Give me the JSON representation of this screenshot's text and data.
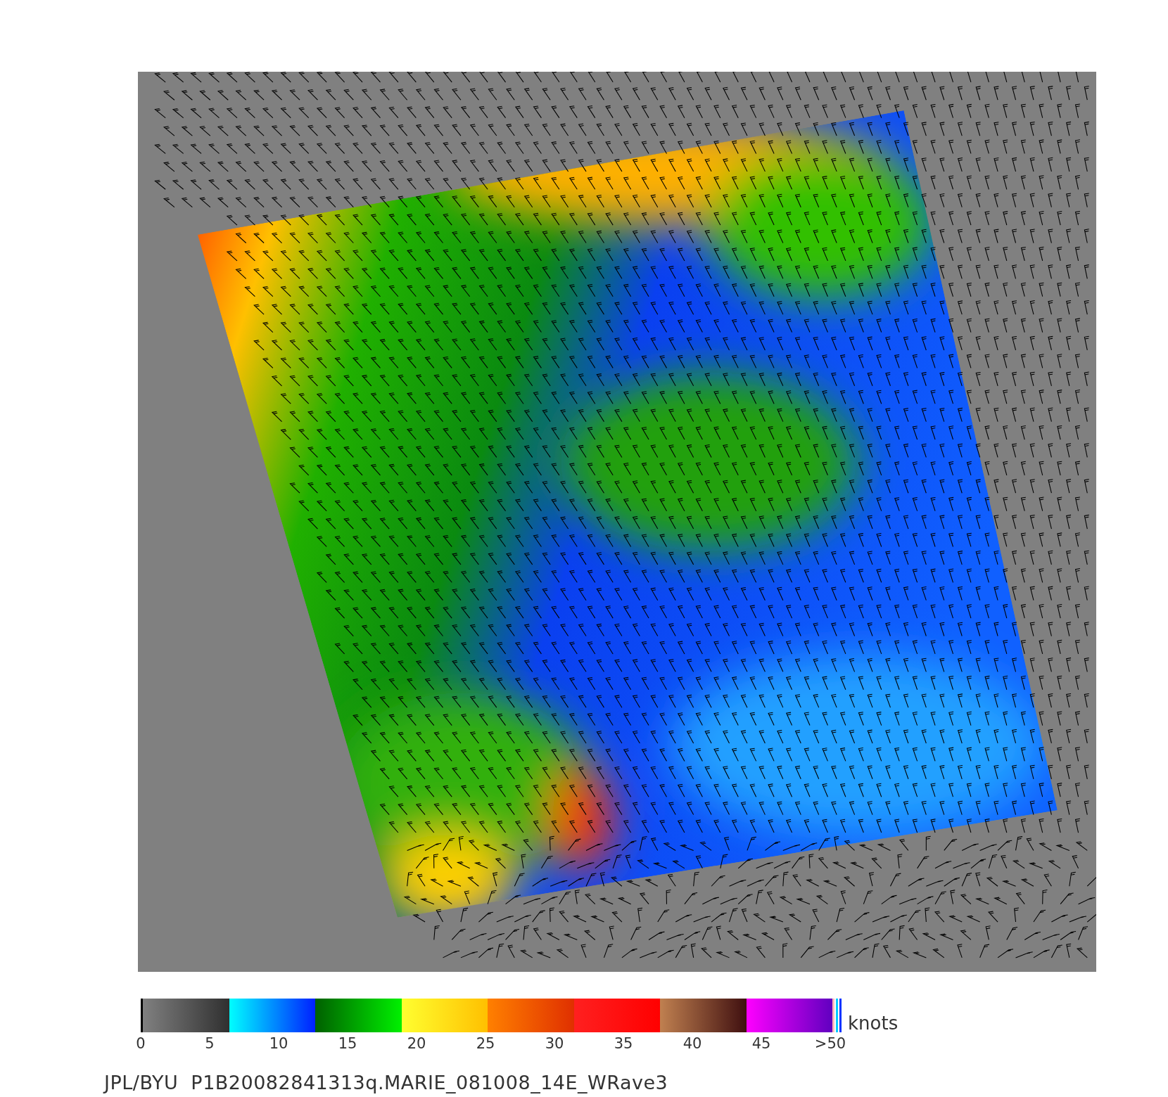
{
  "colorbar": {
    "ticks": [
      "0",
      "5",
      "10",
      "15",
      "20",
      "25",
      "30",
      "35",
      "40",
      "45",
      ">50"
    ],
    "unit": "knots"
  },
  "caption": "JPL/BYU  P1B20082841313q.MARIE_081008_14E_WRave3"
}
